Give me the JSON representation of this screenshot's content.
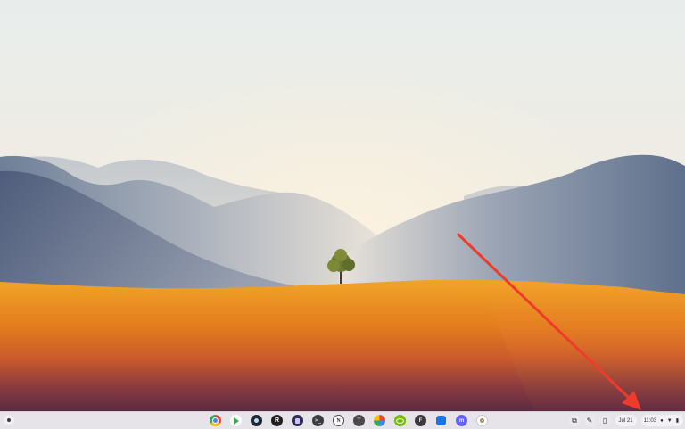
{
  "desktop": {
    "wallpaper": "desert-hills-tree"
  },
  "shelf": {
    "launcher_icon": "circle-launcher-icon",
    "apps": [
      {
        "name": "Chrome",
        "icon": "chrome-icon"
      },
      {
        "name": "Play Store",
        "icon": "play-store-icon"
      },
      {
        "name": "Steam",
        "icon": "steam-icon"
      },
      {
        "name": "Roblox",
        "icon": "roblox-icon",
        "glyph": "R"
      },
      {
        "name": "Dark app",
        "icon": "dark-app-icon"
      },
      {
        "name": "Terminal",
        "icon": "terminal-icon",
        "glyph": ">_"
      },
      {
        "name": "Notion",
        "icon": "notion-icon",
        "glyph": "N"
      },
      {
        "name": "T app",
        "icon": "t-app-icon",
        "glyph": "T"
      },
      {
        "name": "Photos",
        "icon": "photos-icon"
      },
      {
        "name": "GeForce Now",
        "icon": "nvidia-icon"
      },
      {
        "name": "F app",
        "icon": "f-app-icon",
        "glyph": "F"
      },
      {
        "name": "Blue app",
        "icon": "blue-square-icon"
      },
      {
        "name": "Mastodon",
        "icon": "mastodon-icon",
        "glyph": "m"
      },
      {
        "name": "Settings",
        "icon": "settings-icon"
      }
    ],
    "tray": {
      "desks_icon": "desks-icon",
      "pen_icon": "stylus-pen-icon",
      "phone_icon": "phone-hub-icon",
      "date": "Jul 21",
      "time": "11:03",
      "status_icons": [
        "notification-dot-icon",
        "wifi-icon",
        "battery-icon"
      ]
    }
  },
  "annotation": {
    "color": "#ee3b2b",
    "points_to": "status-area"
  }
}
